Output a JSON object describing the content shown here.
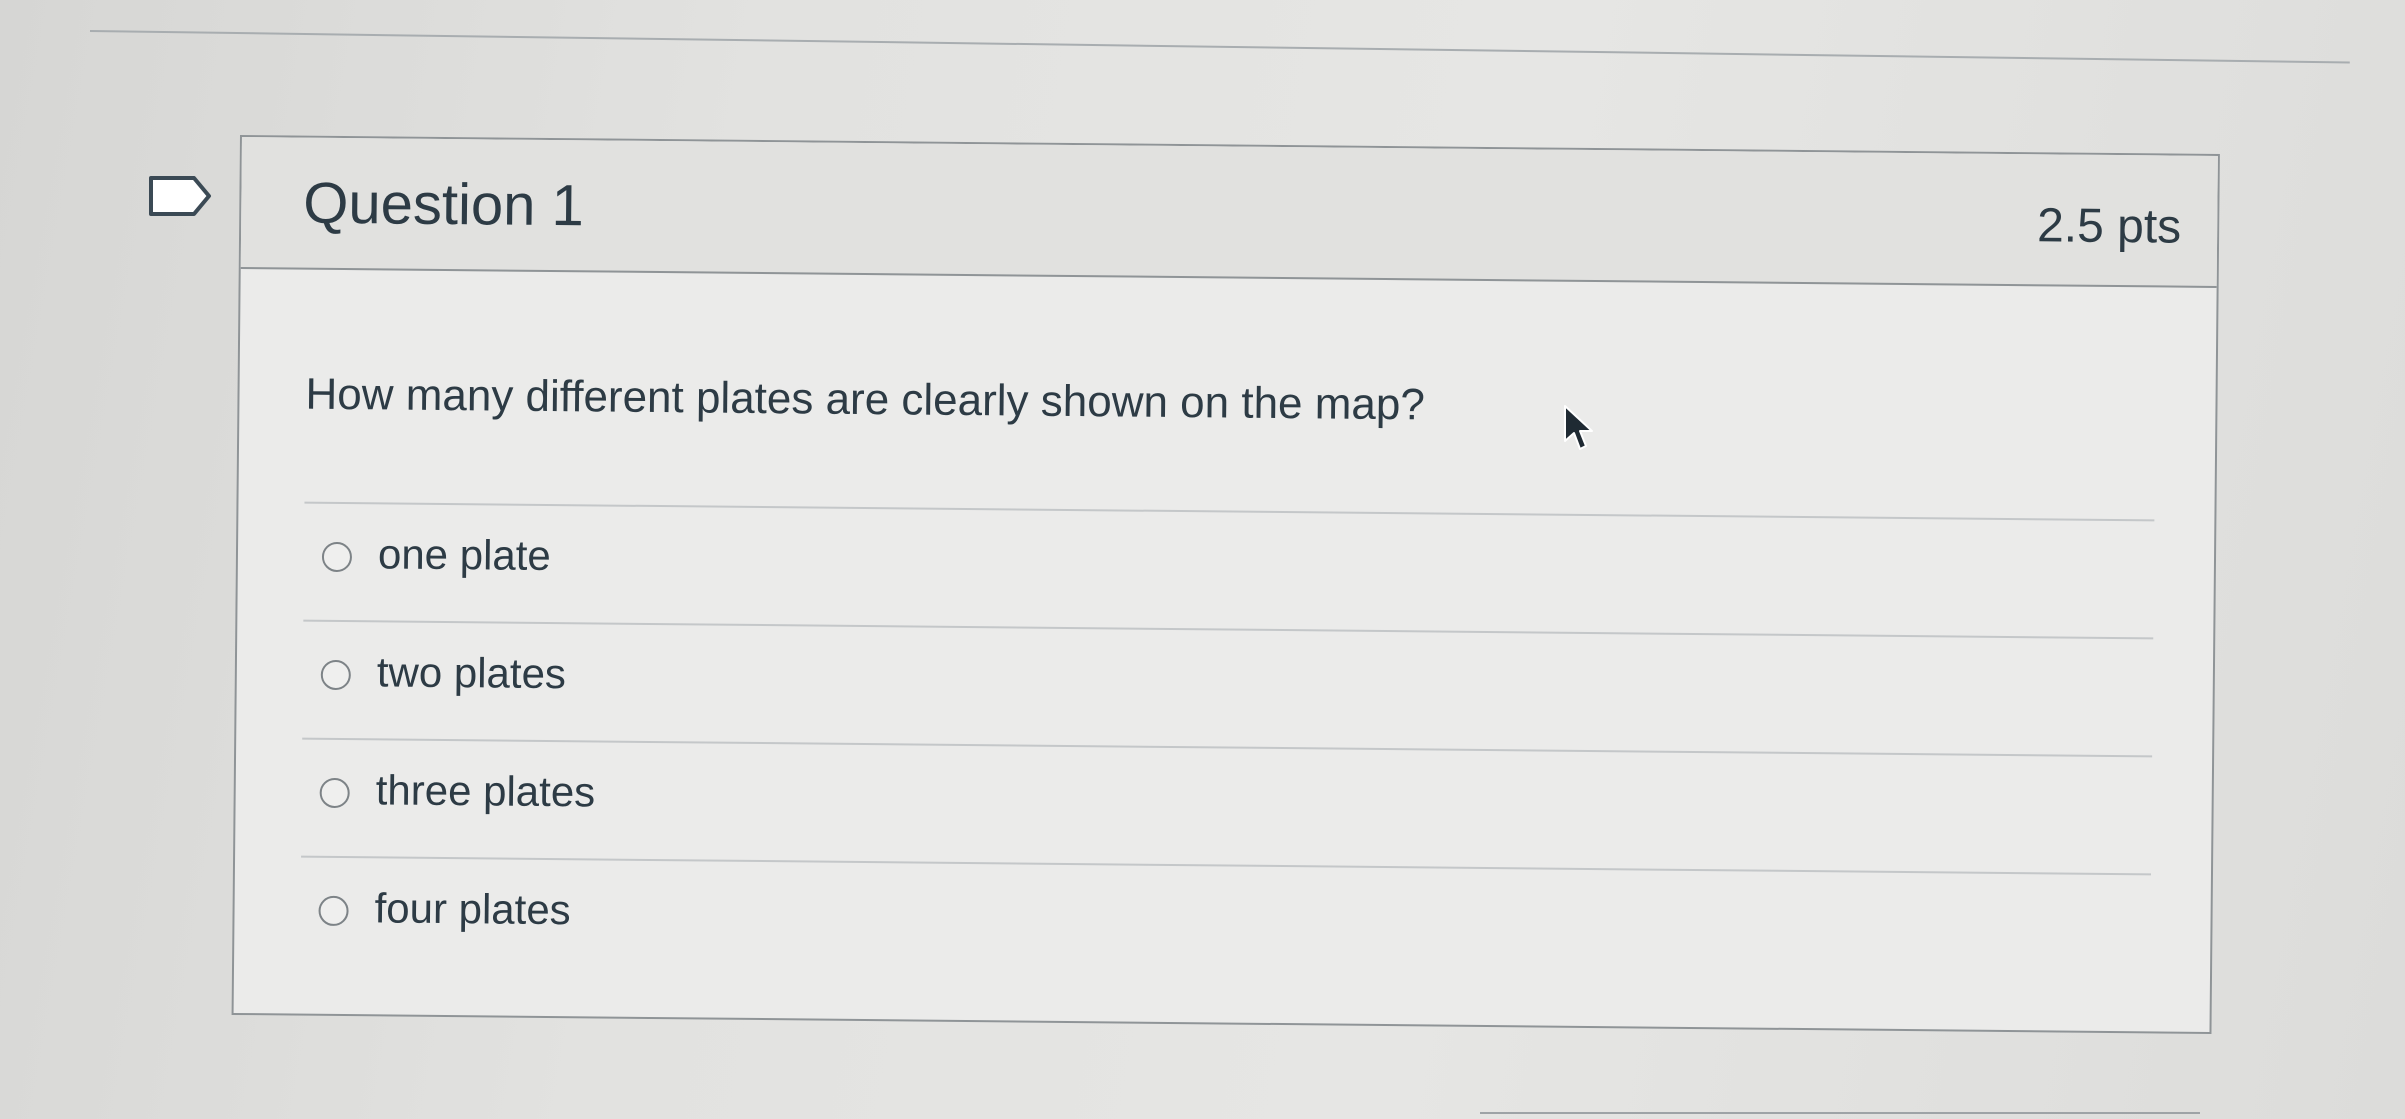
{
  "question": {
    "title": "Question 1",
    "points": "2.5 pts",
    "text": "How many different plates are clearly shown on the map?"
  },
  "answers": [
    {
      "label": "one plate",
      "selected": false
    },
    {
      "label": "two plates",
      "selected": false
    },
    {
      "label": "three plates",
      "selected": false
    },
    {
      "label": "four plates",
      "selected": false
    }
  ],
  "icons": {
    "bookmark": "bookmark-flag-icon",
    "cursor": "mouse-pointer-icon"
  },
  "colors": {
    "text": "#2d3b45",
    "border": "#8f9497",
    "header_bg": "#e1e1df",
    "body_bg": "#ebebea"
  }
}
